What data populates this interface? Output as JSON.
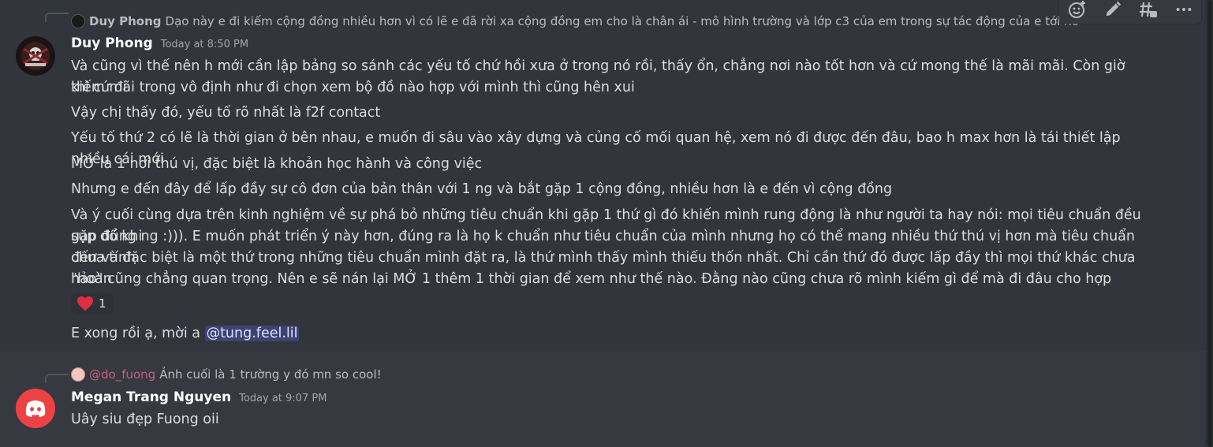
{
  "messages": [
    {
      "reply": {
        "author": "Duy Phong",
        "text": "Dạo này e đi kiếm cộng đồng nhiều hơn vì có lẽ e đã rời xa cộng đồng em cho là chân ái - mô hình trường và lớp c3 của em trong sự tác động của e tới nó"
      },
      "author": "Duy Phong",
      "timestamp": "Today at 8:50 PM",
      "lines": [
        "Và cũng vì thế nên h mới cần lập bảng so sánh các yếu tố chứ hồi xưa ở trong nó rồi, thấy ổn, chẳng nơi nào tốt hơn và cứ mong thế là mãi mãi. Còn giờ thì cứ đi",
        "kiếm mãi trong vô định như đi chọn xem bộ đồ nào hợp với mình thì cũng hên xui",
        "Vậy chị thấy đó, yếu tố rõ nhất là f2f contact",
        "Yếu tố thứ 2 có lẽ là thời gian ở bên nhau, e muốn đi sâu vào xây dựng và củng cố mối quan hệ, xem nó đi được đến đâu, bao h max hơn là tái thiết lập nhiều cái mới",
        "MỞ là 1 nơi thú vị, đặc biệt là khoản học hành và công việc",
        "Nhưng e đến đây để lấp đầy sự cô đơn của bản thân với 1 ng và bắt gặp 1 cộng đồng, nhiều hơn là e đến vì cộng đồng",
        "Và ý cuối cùng dựa trên kinh nghiệm về sự phá bỏ những tiêu chuẩn khi gặp 1 thứ gì đó khiến mình rung động là như người ta hay nói: mọi tiêu chuẩn đều sụp đổ khi",
        "gặp đúng ng :))). E muốn phát triển ý này hơn, đúng ra là họ k chuẩn như tiêu chuẩn của mình nhưng họ có thể mang nhiều thứ thú vị hơn mà tiêu chuẩn chưa tính",
        "đến và đặc biệt là một thứ trong những tiêu chuẩn mình đặt ra, là thứ mình thấy mình thiếu thốn nhất. Chỉ cần thứ đó được lấp đầy thì mọi thứ khác chưa \"hoàn",
        "hảo\" cũng chẳng quan trọng. Nên e sẽ nán lại MỞ 1 thêm 1 thời gian để xem như thế nào. Đằng nào cũng chưa rõ mình kiếm gì để mà đi đâu cho hợp"
      ],
      "reaction": {
        "emoji": "heart",
        "count": "1"
      },
      "followup": {
        "text": "E xong rồi ạ, mời a ",
        "mention": "@tung.feel.lil"
      }
    },
    {
      "reply": {
        "author": "@do_fuong",
        "text": "Ảnh cuối là 1 trường y đó mn so cool!"
      },
      "author": "Megan Trang Nguyen",
      "timestamp": "Today at 9:07 PM",
      "lines": [
        "Uây siu đẹp Fuong oii"
      ]
    }
  ],
  "toolbar": [
    "add-reaction-icon",
    "edit-icon",
    "create-thread-icon",
    "more-icon"
  ],
  "colors": {
    "background": "#36393f",
    "hover_background": "#32353b",
    "mention_bg": "#414675",
    "discord_red": "#ed4245",
    "heart": "#dd2e44"
  }
}
